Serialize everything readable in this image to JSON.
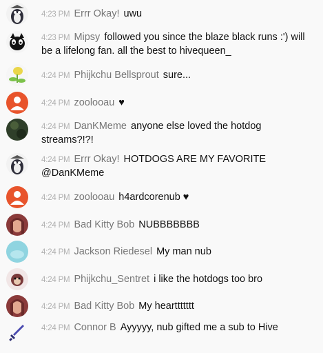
{
  "messages": [
    {
      "time": "4:23 PM",
      "author": "Errr Okay!",
      "text": "uwu",
      "avatar": "penguin-bird-avatar",
      "avatar_color": "#3a3a4a"
    },
    {
      "time": "4:23 PM",
      "author": "Mipsy",
      "text": "followed you since the blaze black runs :') will be a lifelong fan. all the best to hivequeen_",
      "avatar": "cat-face-avatar",
      "avatar_color": "#222222"
    },
    {
      "time": "4:24 PM",
      "author": "Phijkchu Bellsprout",
      "text": "sure...",
      "avatar": "bellsprout-avatar",
      "avatar_color": "#e8d84a"
    },
    {
      "time": "4:24 PM",
      "author": "zoolooau",
      "text": "♥",
      "avatar": "default-person-avatar",
      "avatar_color": "#e8542c"
    },
    {
      "time": "4:24 PM",
      "author": "DanKMeme",
      "text": "anyone else loved the hotdog streams?!?!",
      "avatar": "dark-green-avatar",
      "avatar_color": "#2f3f2a"
    },
    {
      "time": "4:24 PM",
      "author": "Errr Okay!",
      "text": "HOTDOGS ARE MY FAVORITE @DanKMeme",
      "avatar": "penguin-bird-avatar",
      "avatar_color": "#3a3a4a"
    },
    {
      "time": "4:24 PM",
      "author": "zoolooau",
      "text": "h4ardcorenub ♥",
      "avatar": "default-person-avatar",
      "avatar_color": "#e8542c"
    },
    {
      "time": "4:24 PM",
      "author": "Bad Kitty Bob",
      "text": "NUBBBBBBB",
      "avatar": "portrait-avatar",
      "avatar_color": "#c97a6a"
    },
    {
      "time": "4:24 PM",
      "author": "Jackson Riedesel",
      "text": "My man nub",
      "avatar": "light-blue-avatar",
      "avatar_color": "#8fd4e0"
    },
    {
      "time": "4:24 PM",
      "author": "Phijkchu_Sentret",
      "text": "i like the hotdogs too bro",
      "avatar": "sentret-avatar",
      "avatar_color": "#7a3a3a"
    },
    {
      "time": "4:24 PM",
      "author": "Bad Kitty Bob",
      "text": "My hearttttttt",
      "avatar": "portrait-avatar",
      "avatar_color": "#c97a6a"
    },
    {
      "time": "4:24 PM",
      "author": "Connor B",
      "text": "Ayyyyy, nub gifted me a sub to Hive",
      "avatar": "sword-avatar",
      "avatar_color": "#4a4ab0"
    }
  ]
}
